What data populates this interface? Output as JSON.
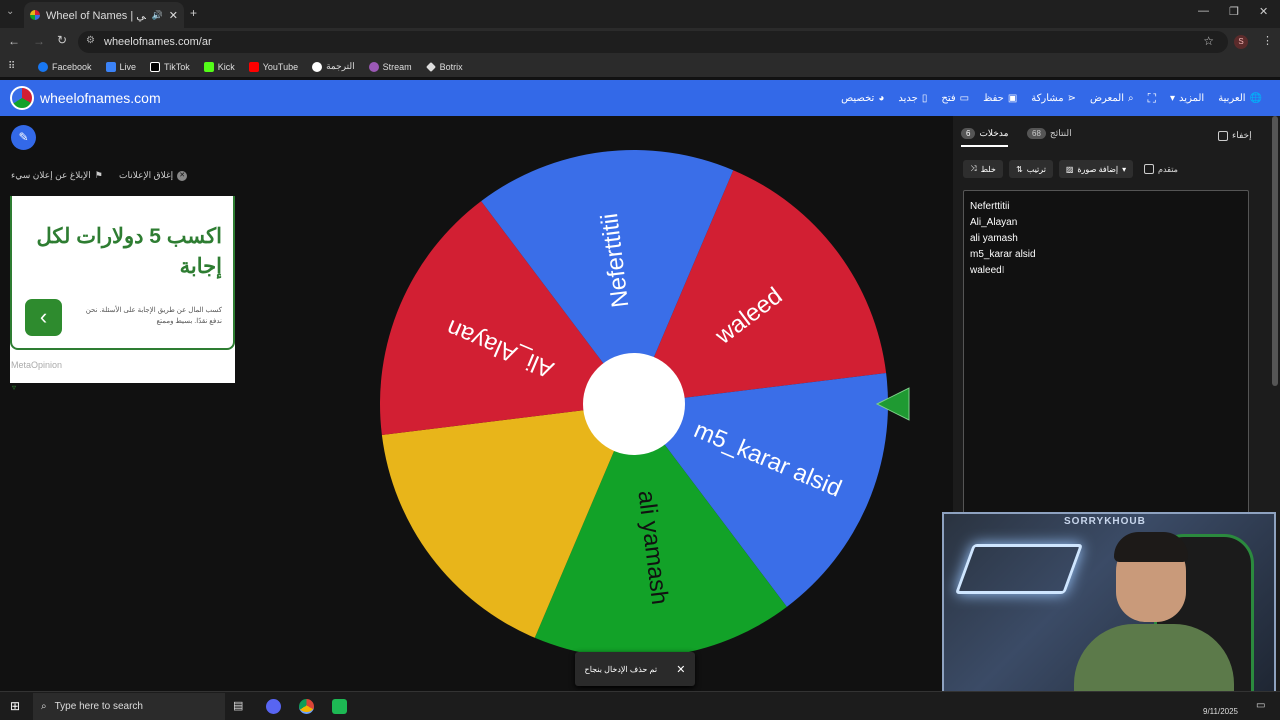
{
  "browser": {
    "tab_title": "Wheel of Names | العشوائي",
    "url": "wheelofnames.com/ar",
    "profile_initial": "S",
    "bookmarks": [
      {
        "label": "Facebook",
        "color": "#1877f2"
      },
      {
        "label": "Live",
        "color": "#3b82f6"
      },
      {
        "label": "TikTok",
        "color": "#ffffff"
      },
      {
        "label": "Kick",
        "color": "#53fc18"
      },
      {
        "label": "YouTube",
        "color": "#ff0000"
      },
      {
        "label": "الترجمة",
        "color": "#4285f4"
      },
      {
        "label": "Stream",
        "color": "#9b59b6"
      },
      {
        "label": "Botrix",
        "color": "#dddddd"
      }
    ]
  },
  "app": {
    "brand": "wheelofnames.com",
    "nav": {
      "language": "العربية",
      "more": "المزيد",
      "gallery": "المعرض",
      "share": "مشاركة",
      "save": "حفظ",
      "open": "فتح",
      "new": "جديد",
      "customize": "تخصيص"
    }
  },
  "ads": {
    "close_ads": "إغلاق الإعلانات",
    "report_ad": "الإبلاغ عن إعلان سيء",
    "headline": "اكسب 5 دولارات لكل إجابة",
    "body": "كسب المال عن طريق الإجابة على الأسئلة. نحن ندفع نقدًا. بسيط وممتع",
    "brand": "MetaOpinion"
  },
  "wheel": {
    "segments": [
      {
        "label": "waleed",
        "color": "#d21f33"
      },
      {
        "label": "m5_karar alsid",
        "color": "#3a6ee8"
      },
      {
        "label": "ali yamash",
        "color": "#12a228"
      },
      {
        "label": "",
        "color": "#e8b51a"
      },
      {
        "label": "Ali_Alayan",
        "color": "#d21f33"
      },
      {
        "label": "Neferttitii",
        "color": "#3a6ee8"
      }
    ]
  },
  "panel": {
    "hide_label": "إخفاء",
    "results_tab": "النتائج",
    "results_count": "68",
    "entries_tab": "مدخلات",
    "entries_count": "6",
    "shuffle": "خلط",
    "sort": "ترتيب",
    "add_image": "إضافة صورة",
    "advanced": "متقدم",
    "entries": [
      "Neferttitii",
      "Ali_Alayan",
      "ali yamash",
      "m5_karar alsid",
      "waleed"
    ]
  },
  "toast": {
    "message": "تم حذف الإدخال بنجاح"
  },
  "taskbar": {
    "search_placeholder": "Type here to search",
    "date": "9/11/2025"
  },
  "webcam": {
    "sign_text": "SORRYKHOUB"
  }
}
